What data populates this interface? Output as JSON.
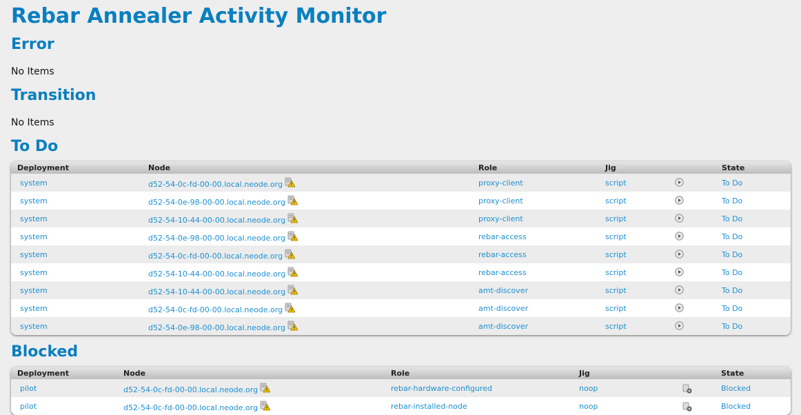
{
  "page_title": "Rebar Annealer Activity Monitor",
  "sections": {
    "error": {
      "title": "Error",
      "empty_text": "No Items"
    },
    "transition": {
      "title": "Transition",
      "empty_text": "No Items"
    },
    "todo": {
      "title": "To Do",
      "columns": [
        "Deployment",
        "Node",
        "Role",
        "Jig",
        "State"
      ],
      "rows": [
        {
          "deployment": "system",
          "node": "d52-54-0c-fd-00-00.local.neode.org",
          "role": "proxy-client",
          "jig": "script",
          "state": "To Do"
        },
        {
          "deployment": "system",
          "node": "d52-54-0e-98-00-00.local.neode.org",
          "role": "proxy-client",
          "jig": "script",
          "state": "To Do"
        },
        {
          "deployment": "system",
          "node": "d52-54-10-44-00-00.local.neode.org",
          "role": "proxy-client",
          "jig": "script",
          "state": "To Do"
        },
        {
          "deployment": "system",
          "node": "d52-54-0e-98-00-00.local.neode.org",
          "role": "rebar-access",
          "jig": "script",
          "state": "To Do"
        },
        {
          "deployment": "system",
          "node": "d52-54-0c-fd-00-00.local.neode.org",
          "role": "rebar-access",
          "jig": "script",
          "state": "To Do"
        },
        {
          "deployment": "system",
          "node": "d52-54-10-44-00-00.local.neode.org",
          "role": "rebar-access",
          "jig": "script",
          "state": "To Do"
        },
        {
          "deployment": "system",
          "node": "d52-54-10-44-00-00.local.neode.org",
          "role": "amt-discover",
          "jig": "script",
          "state": "To Do"
        },
        {
          "deployment": "system",
          "node": "d52-54-0c-fd-00-00.local.neode.org",
          "role": "amt-discover",
          "jig": "script",
          "state": "To Do"
        },
        {
          "deployment": "system",
          "node": "d52-54-0e-98-00-00.local.neode.org",
          "role": "amt-discover",
          "jig": "script",
          "state": "To Do"
        }
      ],
      "node_status_icon": "warning-node-icon",
      "jig_icon": "run-script-icon"
    },
    "blocked": {
      "title": "Blocked",
      "columns": [
        "Deployment",
        "Node",
        "Role",
        "Jig",
        "State"
      ],
      "rows": [
        {
          "deployment": "pilot",
          "node": "d52-54-0c-fd-00-00.local.neode.org",
          "role": "rebar-hardware-configured",
          "jig": "noop",
          "state": "Blocked"
        },
        {
          "deployment": "pilot",
          "node": "d52-54-0c-fd-00-00.local.neode.org",
          "role": "rebar-installed-node",
          "jig": "noop",
          "state": "Blocked"
        }
      ],
      "node_status_icon": "warning-node-icon",
      "jig_icon": "gear-icon"
    }
  },
  "colors": {
    "heading": "#0a7fbf",
    "link": "#1d8fd0",
    "row_alt": "#ececec",
    "header_gradient_top": "#e6e6e6",
    "header_gradient_bottom": "#bdbdbd"
  }
}
